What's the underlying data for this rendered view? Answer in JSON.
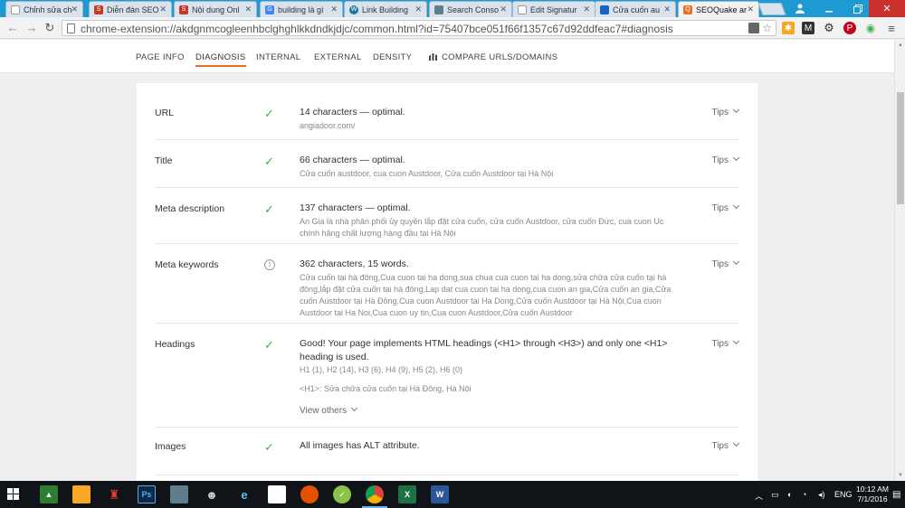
{
  "tabs": [
    {
      "title": "Chỉnh sửa ch",
      "icon": "page-icon",
      "color": "#9e9e9e"
    },
    {
      "title": "Diễn đàn SEO",
      "icon": "seo-forum-icon",
      "color": "#c0392b"
    },
    {
      "title": "Nội dung Onl",
      "icon": "seo-forum-icon",
      "color": "#c0392b"
    },
    {
      "title": "building là gì",
      "icon": "google-icon",
      "color": "#4285f4"
    },
    {
      "title": "Link Building",
      "icon": "wordpress-icon",
      "color": "#21759b"
    },
    {
      "title": "Search Conso",
      "icon": "search-console-icon",
      "color": "#607d8b"
    },
    {
      "title": "Edit Signatur",
      "icon": "page-icon",
      "color": "#9e9e9e"
    },
    {
      "title": "Cửa cuốn au",
      "icon": "blue-site-icon",
      "color": "#1565c0"
    },
    {
      "title": "SEOQuake ar",
      "icon": "seoquake-icon",
      "color": "#e8712a"
    }
  ],
  "address": {
    "url": "chrome-extension://akdgnmcogleenhbclghghlkkdndkjdjc/common.html?id=75407bce051f66f1357c67d92ddfeac7#diagnosis"
  },
  "colors": {
    "accent": "#e8712a",
    "check": "#4aa84a",
    "tabstrip": "#1e9ad3"
  },
  "nav": {
    "page_info": "PAGE INFO",
    "diagnosis": "DIAGNOSIS",
    "internal": "INTERNAL",
    "external": "EXTERNAL",
    "density": "DENSITY",
    "compare": "COMPARE URLS/DOMAINS"
  },
  "rows": [
    {
      "label": "URL",
      "status": "check",
      "main": "14 characters — optimal.",
      "sub": "angiadoor.com/",
      "tips": "Tips"
    },
    {
      "label": "Title",
      "status": "check",
      "main": "66 characters — optimal.",
      "sub": "Cửa cuốn austdoor, cua cuon Austdoor, Cửa cuốn Austdoor tại Hà Nội",
      "tips": "Tips"
    },
    {
      "label": "Meta description",
      "status": "check",
      "main": "137 characters — optimal.",
      "sub": "An Gia là nhà phân phối ủy quyền lắp đặt cửa cuốn, cửa cuốn Austdoor, cửa cuốn Đức, cua cuon Uc chính hãng chất lượng hàng đầu tại Hà Nội",
      "tips": "Tips"
    },
    {
      "label": "Meta keywords",
      "status": "info",
      "main": "362 characters, 15 words.",
      "sub": "Cửa cuốn tại hà đông,Cua cuon tai ha dong,sua chua cua cuon tai ha dong,sửa chữa cửa cuốn tại hà đông,lắp đặt cửa cuốn tại hà đông,Lap dat cua cuon tai ha dong,cua cuon an gia,Cửa cuốn an gia,Cửa cuốn Austdoor tại Hà Đông,Cua cuon Austdoor tai Ha Dong,Cửa cuốn Austdoor tại Hà Nội,Cua cuon Austdoor tai Ha Noi,Cua cuon uy tin,Cua cuon Austdoor,Cửa cuốn Austdoor",
      "tips": "Tips"
    },
    {
      "label": "Headings",
      "status": "check",
      "main": "Good! Your page implements HTML headings (<H1> through <H3>) and only one <H1> heading is used.",
      "sub": "H1 (1), H2 (14), H3 (6), H4 (9), H5 (2), H6 (0)",
      "sub2": "<H1>: Sửa chữa cửa cuốn tại Hà Đông, Hà Nội",
      "view_others": "View others",
      "tips": "Tips"
    },
    {
      "label": "Images",
      "status": "check",
      "main": "All images has ALT attribute.",
      "tips": "Tips"
    }
  ],
  "taskbar": {
    "lang": "ENG",
    "time": "10:12 AM",
    "date": "7/1/2016"
  }
}
